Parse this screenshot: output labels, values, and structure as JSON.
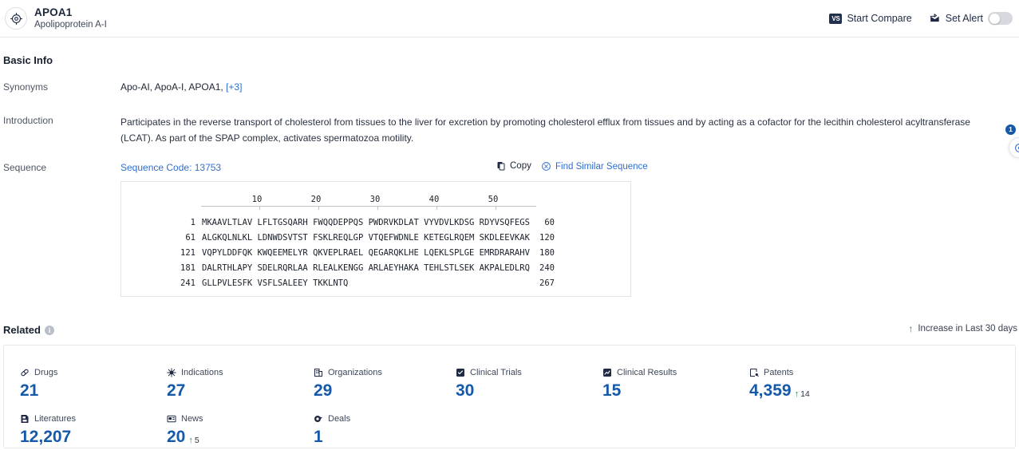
{
  "header": {
    "icon": "target-icon",
    "title": "APOA1",
    "subtitle": "Apolipoprotein A-I",
    "compare_label": "Start Compare",
    "compare_icon_text": "VS",
    "alert_label": "Set Alert",
    "alert_icon": "alert-bell-icon",
    "alert_toggle_on": false
  },
  "basic_info": {
    "title": "Basic Info",
    "synonyms_label": "Synonyms",
    "synonyms_value": "Apo-AI, ApoA-I, APOA1,",
    "synonyms_more": "[+3]",
    "introduction_label": "Introduction",
    "introduction_value": "Participates in the reverse transport of cholesterol from tissues to the liver for excretion by promoting cholesterol efflux from tissues and by acting as a cofactor for the lecithin cholesterol acyltransferase (LCAT). As part of the SPAP complex, activates spermatozoa motility.",
    "sequence_label": "Sequence",
    "sequence_code": "Sequence Code: 13753",
    "copy_label": "Copy",
    "copy_icon": "copy-icon",
    "find_similar_label": "Find Similar Sequence",
    "find_similar_icon": "dna-search-icon"
  },
  "sequence": {
    "ruler_ticks": [
      "10",
      "20",
      "30",
      "40",
      "50"
    ],
    "rows": [
      {
        "start": "1",
        "chunks": "MKAAVLTLAV LFLTGSQARH FWQQDEPPQS PWDRVKDLAT VYVDVLKDSG RDYVSQFEGS",
        "end": "60"
      },
      {
        "start": "61",
        "chunks": "ALGKQLNLKL LDNWDSVTST FSKLREQLGP VTQEFWDNLE KETEGLRQEM SKDLEEVKAK",
        "end": "120"
      },
      {
        "start": "121",
        "chunks": "VQPYLDDFQK KWQEEMELYR QKVEPLRAEL QEGARQKLHE LQEKLSPLGE EMRDRARAHV",
        "end": "180"
      },
      {
        "start": "181",
        "chunks": "DALRTHLAPY SDELRQRLAA RLEALKENGG ARLAEYHAKA TEHLSTLSEK AKPALEDLRQ",
        "end": "240"
      },
      {
        "start": "241",
        "chunks": "GLLPVLESFK VSFLSALEEY TKKLNTQ",
        "end": "267"
      }
    ]
  },
  "related": {
    "title": "Related",
    "info_icon": "info-icon",
    "legend": "Increase in Last 30 days",
    "legend_icon": "up-arrow-icon",
    "cards": [
      {
        "label": "Drugs",
        "icon": "pill-icon",
        "value": "21",
        "delta": ""
      },
      {
        "label": "Indications",
        "icon": "virus-icon",
        "value": "27",
        "delta": ""
      },
      {
        "label": "Organizations",
        "icon": "building-icon",
        "value": "29",
        "delta": ""
      },
      {
        "label": "Clinical Trials",
        "icon": "clinical-trial-icon",
        "value": "30",
        "delta": ""
      },
      {
        "label": "Clinical Results",
        "icon": "clinical-result-icon",
        "value": "15",
        "delta": ""
      },
      {
        "label": "Patents",
        "icon": "patent-icon",
        "value": "4,359",
        "delta": "14"
      },
      {
        "label": "Literatures",
        "icon": "literature-icon",
        "value": "12,207",
        "delta": ""
      },
      {
        "label": "News",
        "icon": "news-icon",
        "value": "20",
        "delta": "5"
      },
      {
        "label": "Deals",
        "icon": "deal-icon",
        "value": "1",
        "delta": ""
      }
    ]
  },
  "floating": {
    "badge_count": "1",
    "badge_name": "notification-badge",
    "fab_icon": "help-chat-icon"
  }
}
